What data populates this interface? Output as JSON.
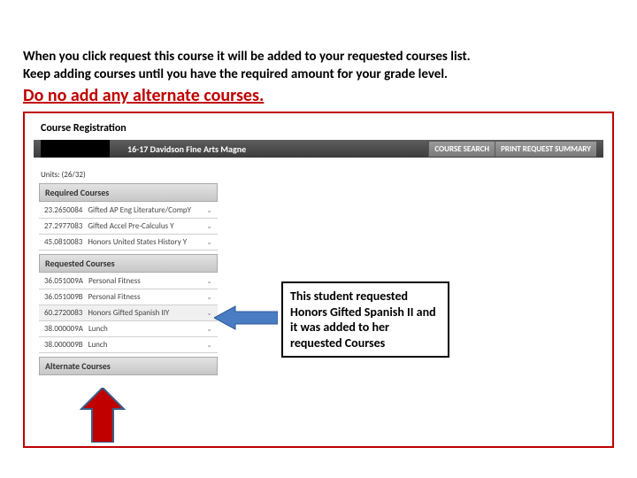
{
  "intro": {
    "line1": "When you click request this course it will be added to your requested courses list.",
    "line2": "Keep adding courses until you have the required amount for your grade level."
  },
  "warning": "Do no add any alternate courses.",
  "registration": {
    "title": "Course Registration",
    "school": "16-17 Davidson Fine Arts Magne",
    "tabs": {
      "search": "COURSE SEARCH",
      "print": "PRINT REQUEST SUMMARY"
    },
    "units": "Units: (26/32)"
  },
  "sections": {
    "required": {
      "label": "Required Courses",
      "courses": [
        {
          "code": "23.2650084",
          "name": "Gifted AP Eng Literature/CompY"
        },
        {
          "code": "27.2977083",
          "name": "Gifted Accel Pre-Calculus Y"
        },
        {
          "code": "45.0810083",
          "name": "Honors United States History Y"
        }
      ]
    },
    "requested": {
      "label": "Requested Courses",
      "courses": [
        {
          "code": "36.051009A",
          "name": "Personal Fitness"
        },
        {
          "code": "36.051009B",
          "name": "Personal Fitness"
        },
        {
          "code": "60.2720083",
          "name": "Honors Gifted Spanish IIY"
        },
        {
          "code": "38.000009A",
          "name": "Lunch"
        },
        {
          "code": "38.000009B",
          "name": "Lunch"
        }
      ]
    },
    "alternate": {
      "label": "Alternate Courses"
    }
  },
  "callout": "This student requested Honors Gifted Spanish II and it was added to her requested Courses"
}
